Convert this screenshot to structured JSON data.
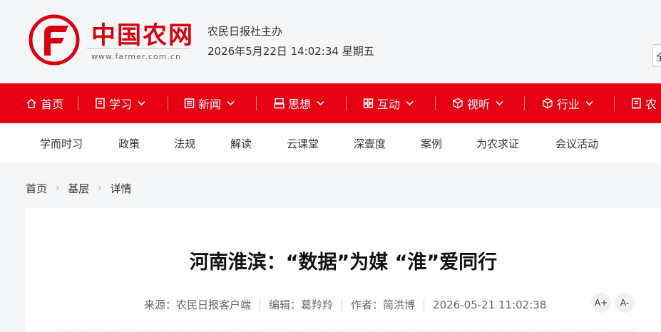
{
  "header": {
    "logo_text": "中国农网",
    "logo_url": "www.farmer.com.cn",
    "host": "农民日报社主办",
    "datetime": "2026年5月22日 14:02:34 星期五",
    "search_stub": "全"
  },
  "colors": {
    "brand_red": "#e60012",
    "logo_red": "#d7000f"
  },
  "mainnav": [
    {
      "label": "首页",
      "icon": "home-icon"
    },
    {
      "label": "学习",
      "icon": "book-icon",
      "dropdown": true
    },
    {
      "label": "新闻",
      "icon": "news-icon",
      "dropdown": true
    },
    {
      "label": "思想",
      "icon": "thought-icon",
      "dropdown": true
    },
    {
      "label": "互动",
      "icon": "grid-icon",
      "dropdown": true
    },
    {
      "label": "视听",
      "icon": "cube-icon",
      "dropdown": true
    },
    {
      "label": "行业",
      "icon": "industry-icon",
      "dropdown": true
    },
    {
      "label": "农",
      "icon": "doc-icon"
    }
  ],
  "subnav": [
    "学而时习",
    "政策",
    "法规",
    "解读",
    "云课堂",
    "深壹度",
    "案例",
    "为农求证",
    "会议活动"
  ],
  "breadcrumb": [
    "首页",
    "基层",
    "详情"
  ],
  "article": {
    "title": "河南淮滨：“数据”为媒 “淮”爱同行",
    "source": "来源：农民日报客户端",
    "editor": "编辑：葛羚羚",
    "author": "作者：简洪博",
    "date": "2026-05-21 11:02:38",
    "font_up": "A+",
    "font_down": "A-"
  }
}
